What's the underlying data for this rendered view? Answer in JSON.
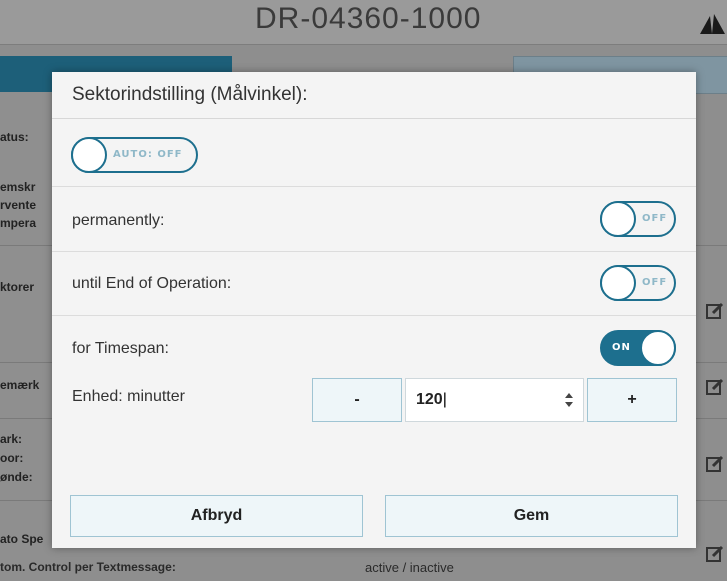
{
  "background": {
    "title": "DR-04360-1000",
    "side_labels": [
      "atus:",
      "emskr",
      "rvente",
      "mpera",
      "ktorer",
      "emærk",
      "ark:",
      "oor:",
      "ønde:",
      "ato Spe"
    ],
    "footer_label": "tom. Control per Textmessage:",
    "footer_value": "active / inactive"
  },
  "modal": {
    "title": "Sektorindstilling (Målvinkel):",
    "auto_toggle": {
      "text": "AUTO: OFF",
      "state": "off"
    },
    "rows": [
      {
        "label": "permanently:",
        "toggle_text": "OFF",
        "state": "off"
      },
      {
        "label": "until End of Operation:",
        "toggle_text": "OFF",
        "state": "off"
      },
      {
        "label": "for Timespan:",
        "toggle_text": "ON",
        "state": "on"
      }
    ],
    "unit_label": "Enhed: minutter",
    "stepper": {
      "minus": "-",
      "value": "120",
      "plus": "+"
    },
    "cancel_label": "Afbryd",
    "save_label": "Gem"
  },
  "colors": {
    "accent": "#1d6f8e",
    "toggle_off_text": "#8fb8c8"
  }
}
